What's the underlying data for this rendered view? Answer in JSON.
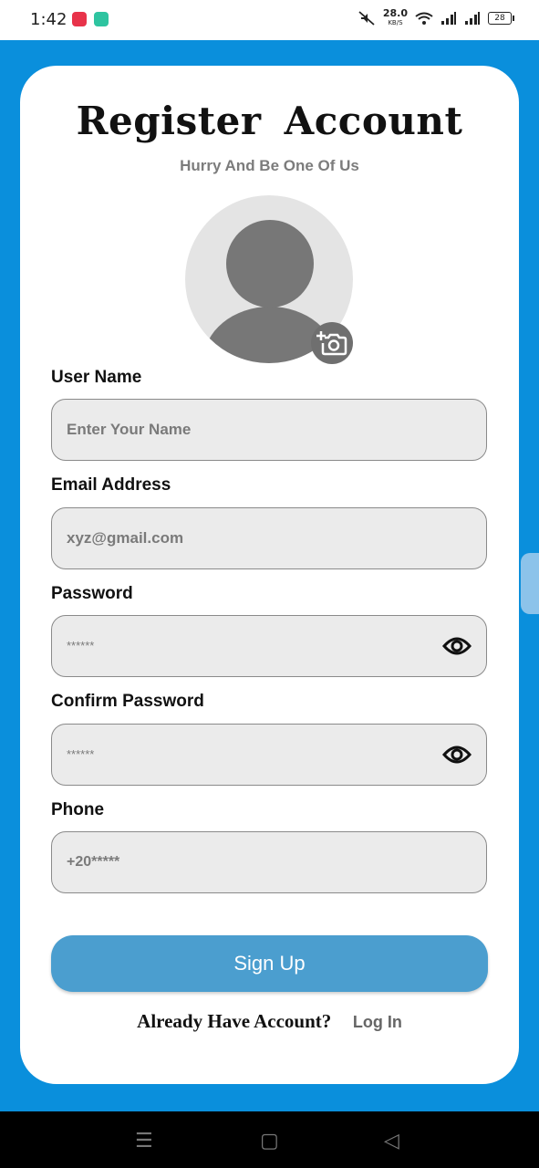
{
  "status": {
    "time": "1:42",
    "speed_value": "28.0",
    "speed_unit": "KB/S",
    "battery": "28"
  },
  "header": {
    "title": "Register  Account",
    "subtitle": "Hurry And Be One Of Us"
  },
  "form": {
    "username": {
      "label": "User Name",
      "placeholder": "Enter Your Name"
    },
    "email": {
      "label": "Email Address",
      "placeholder": "xyz@gmail.com"
    },
    "password": {
      "label": "Password",
      "placeholder": "******"
    },
    "confirm": {
      "label": "Confirm Password",
      "placeholder": "******"
    },
    "phone": {
      "label": "Phone",
      "placeholder": "+20*****"
    }
  },
  "actions": {
    "signup_label": "Sign Up",
    "login_prompt": "Already Have Account?",
    "login_link": "Log In"
  },
  "icons": {
    "camera": "camera-add-icon",
    "eye": "eye-icon"
  },
  "colors": {
    "accent": "#0a8fdc",
    "button": "#4b9ecf"
  }
}
